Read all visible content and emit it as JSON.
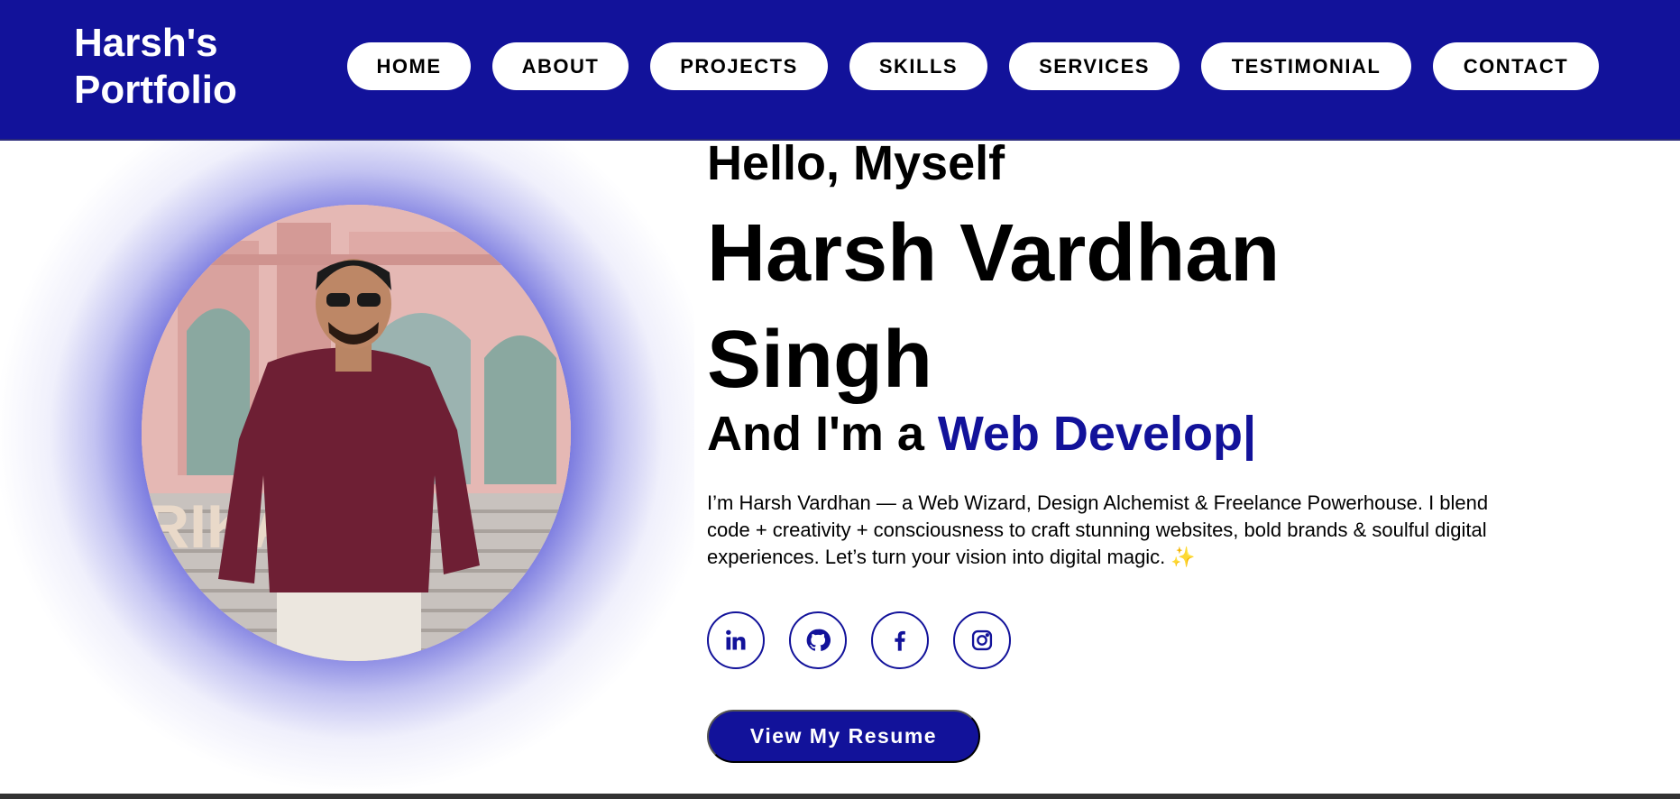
{
  "navbar": {
    "brand_line1": "Harsh's",
    "brand_line2": "Portfolio",
    "items": [
      {
        "label": "HOME"
      },
      {
        "label": "ABOUT"
      },
      {
        "label": "PROJECTS"
      },
      {
        "label": "SKILLS"
      },
      {
        "label": "SERVICES"
      },
      {
        "label": "TESTIMONIAL"
      },
      {
        "label": "CONTACT"
      }
    ]
  },
  "hero": {
    "greeting": "Hello, Myself",
    "name": "Harsh Vardhan Singh",
    "role_prefix": "And I'm a ",
    "role_typed": "Web Develop|",
    "bio": "I’m Harsh Vardhan — a Web Wizard, Design Alchemist & Freelance Powerhouse. I blend code + creativity + consciousness to craft stunning websites, bold brands & soulful digital experiences. Let’s turn your vision into digital magic. ✨",
    "resume_button": "View My Resume",
    "social": [
      {
        "icon": "linkedin-icon"
      },
      {
        "icon": "github-icon"
      },
      {
        "icon": "facebook-icon"
      },
      {
        "icon": "instagram-icon"
      }
    ]
  },
  "colors": {
    "primary": "#12129a",
    "background": "#ffffff",
    "text": "#000000"
  }
}
